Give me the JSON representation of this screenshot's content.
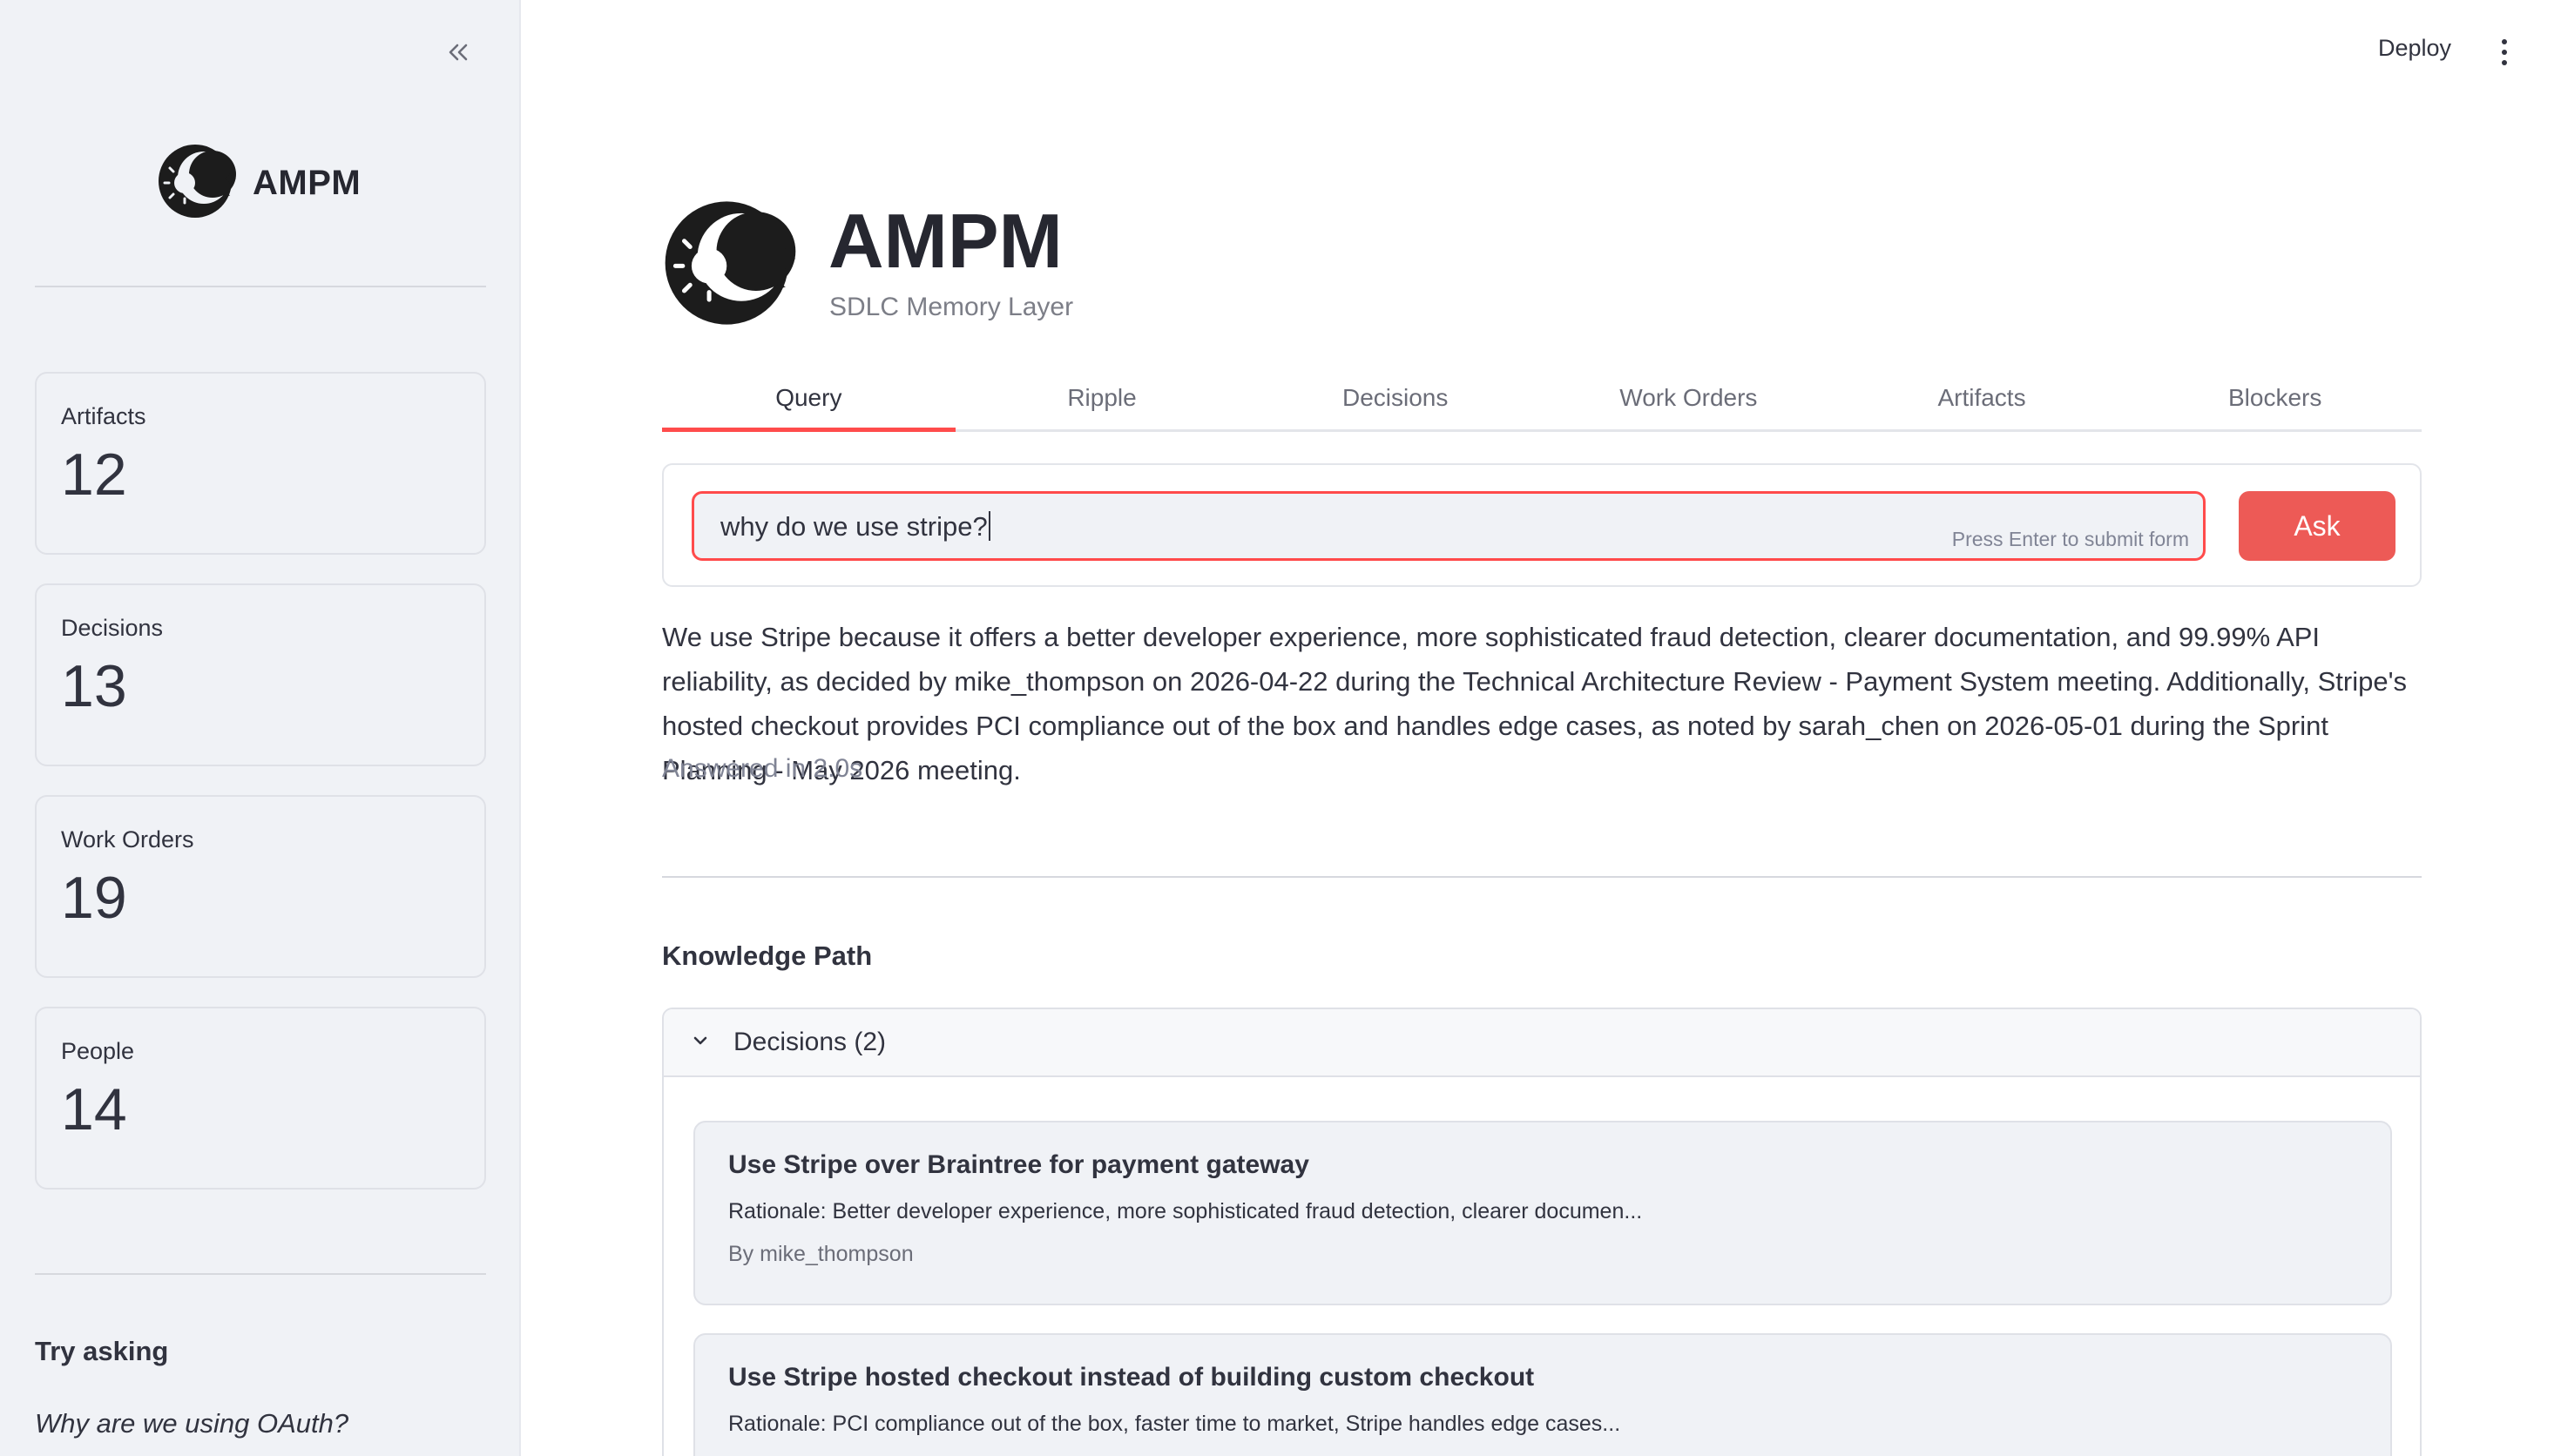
{
  "sidebar": {
    "brand": "AMPM",
    "metrics": [
      {
        "label": "Artifacts",
        "value": "12"
      },
      {
        "label": "Decisions",
        "value": "13"
      },
      {
        "label": "Work Orders",
        "value": "19"
      },
      {
        "label": "People",
        "value": "14"
      }
    ],
    "try_asking": {
      "title": "Try asking",
      "items": [
        "Why are we using OAuth?"
      ]
    }
  },
  "header": {
    "deploy_label": "Deploy"
  },
  "main": {
    "title": "AMPM",
    "subtitle": "SDLC Memory Layer",
    "tabs": [
      {
        "label": "Query"
      },
      {
        "label": "Ripple"
      },
      {
        "label": "Decisions"
      },
      {
        "label": "Work Orders"
      },
      {
        "label": "Artifacts"
      },
      {
        "label": "Blockers"
      }
    ],
    "query": {
      "value": "why do we use stripe?",
      "hint": "Press Enter to submit form",
      "button_label": "Ask"
    },
    "answer": "We use Stripe because it offers a better developer experience, more sophisticated fraud detection, clearer documentation, and 99.99% API reliability, as decided by mike_thompson on 2026-04-22 during the Technical Architecture Review - Payment System meeting. Additionally, Stripe's hosted checkout provides PCI compliance out of the box and handles edge cases, as noted by sarah_chen on 2026-05-01 during the Sprint Planning - May 2026 meeting.",
    "answered_in": "Answered in 2.0s",
    "knowledge_path": {
      "title": "Knowledge Path",
      "expander_label": "Decisions (2)",
      "decisions": [
        {
          "title": "Use Stripe over Braintree for payment gateway",
          "rationale": "Rationale: Better developer experience, more sophisticated fraud detection, clearer documen...",
          "by": "By mike_thompson"
        },
        {
          "title": "Use Stripe hosted checkout instead of building custom checkout",
          "rationale": "Rationale: PCI compliance out of the box, faster time to market, Stripe handles edge cases...",
          "by": ""
        }
      ]
    }
  },
  "colors": {
    "accent": "#ff4b4b",
    "button": "#ed5a56",
    "sidebar_bg": "#f0f2f6"
  },
  "icons": [
    "collapse-sidebar-icon",
    "ampm-logo-icon",
    "kebab-menu-icon",
    "chevron-down-icon"
  ]
}
